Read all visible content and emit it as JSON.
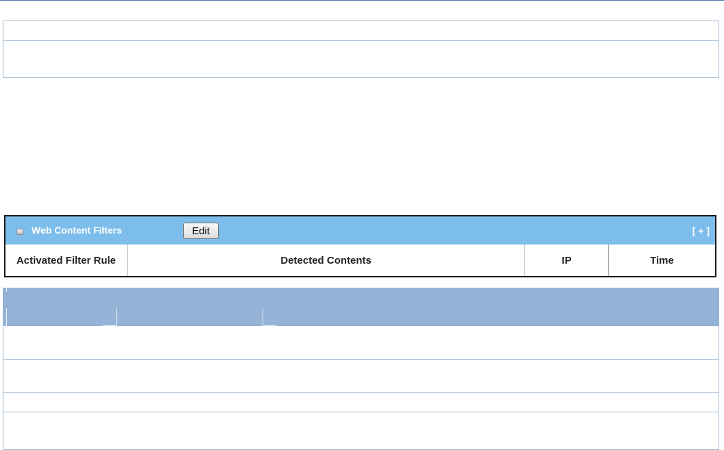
{
  "widget": {
    "title": "Web Content Filters",
    "edit_label": "Edit",
    "expand_label": "[ + ]",
    "header_color": "#7cbdeb",
    "columns": [
      "Activated Filter Rule",
      "Detected Contents",
      "IP",
      "Time"
    ]
  },
  "colors": {
    "table_border": "#9cb4cf",
    "lower_header": "#95b3d7"
  }
}
